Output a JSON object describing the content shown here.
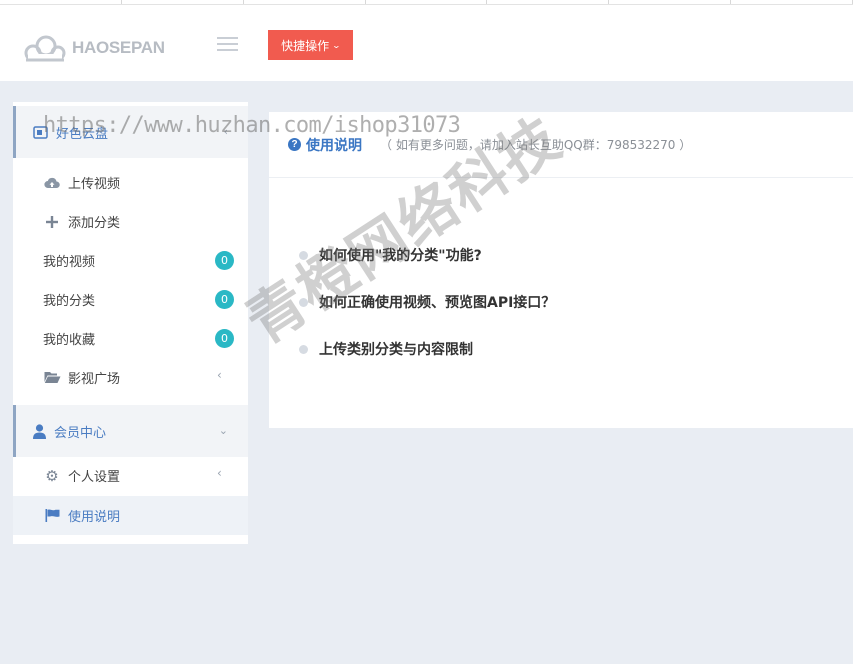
{
  "header": {
    "logo_text": "HAOSEPAN",
    "quick_action_label": "快捷操作"
  },
  "sidebar": {
    "group_disk": {
      "label": "好色云盘"
    },
    "items": [
      {
        "label": "上传视频",
        "icon": "cloud-upload-icon"
      },
      {
        "label": "添加分类",
        "icon": "plus-icon"
      },
      {
        "label": "我的视频",
        "badge": "0"
      },
      {
        "label": "我的分类",
        "badge": "0"
      },
      {
        "label": "我的收藏",
        "badge": "0"
      },
      {
        "label": "影视广场",
        "icon": "folder-open-icon"
      }
    ],
    "group_member": {
      "label": "会员中心"
    },
    "member_items": [
      {
        "label": "个人设置",
        "icon": "gear-icon"
      },
      {
        "label": "使用说明",
        "icon": "flag-icon"
      }
    ]
  },
  "main": {
    "title": "使用说明",
    "hint": "（ 如有更多问题，请加入站长互助QQ群：798532270 ）",
    "faq": [
      "如何使用\"我的分类\"功能?",
      "如何正确使用视频、预览图API接口？",
      "上传类别分类与内容限制"
    ]
  },
  "watermarks": {
    "url": "https://www.huzhan.com/ishop31073",
    "company": "青橙网络科技"
  },
  "colors": {
    "accent_blue": "#3a76c3",
    "quick_button": "#f15b4f",
    "badge": "#2ab8c5",
    "page_bg": "#e9edf3"
  }
}
